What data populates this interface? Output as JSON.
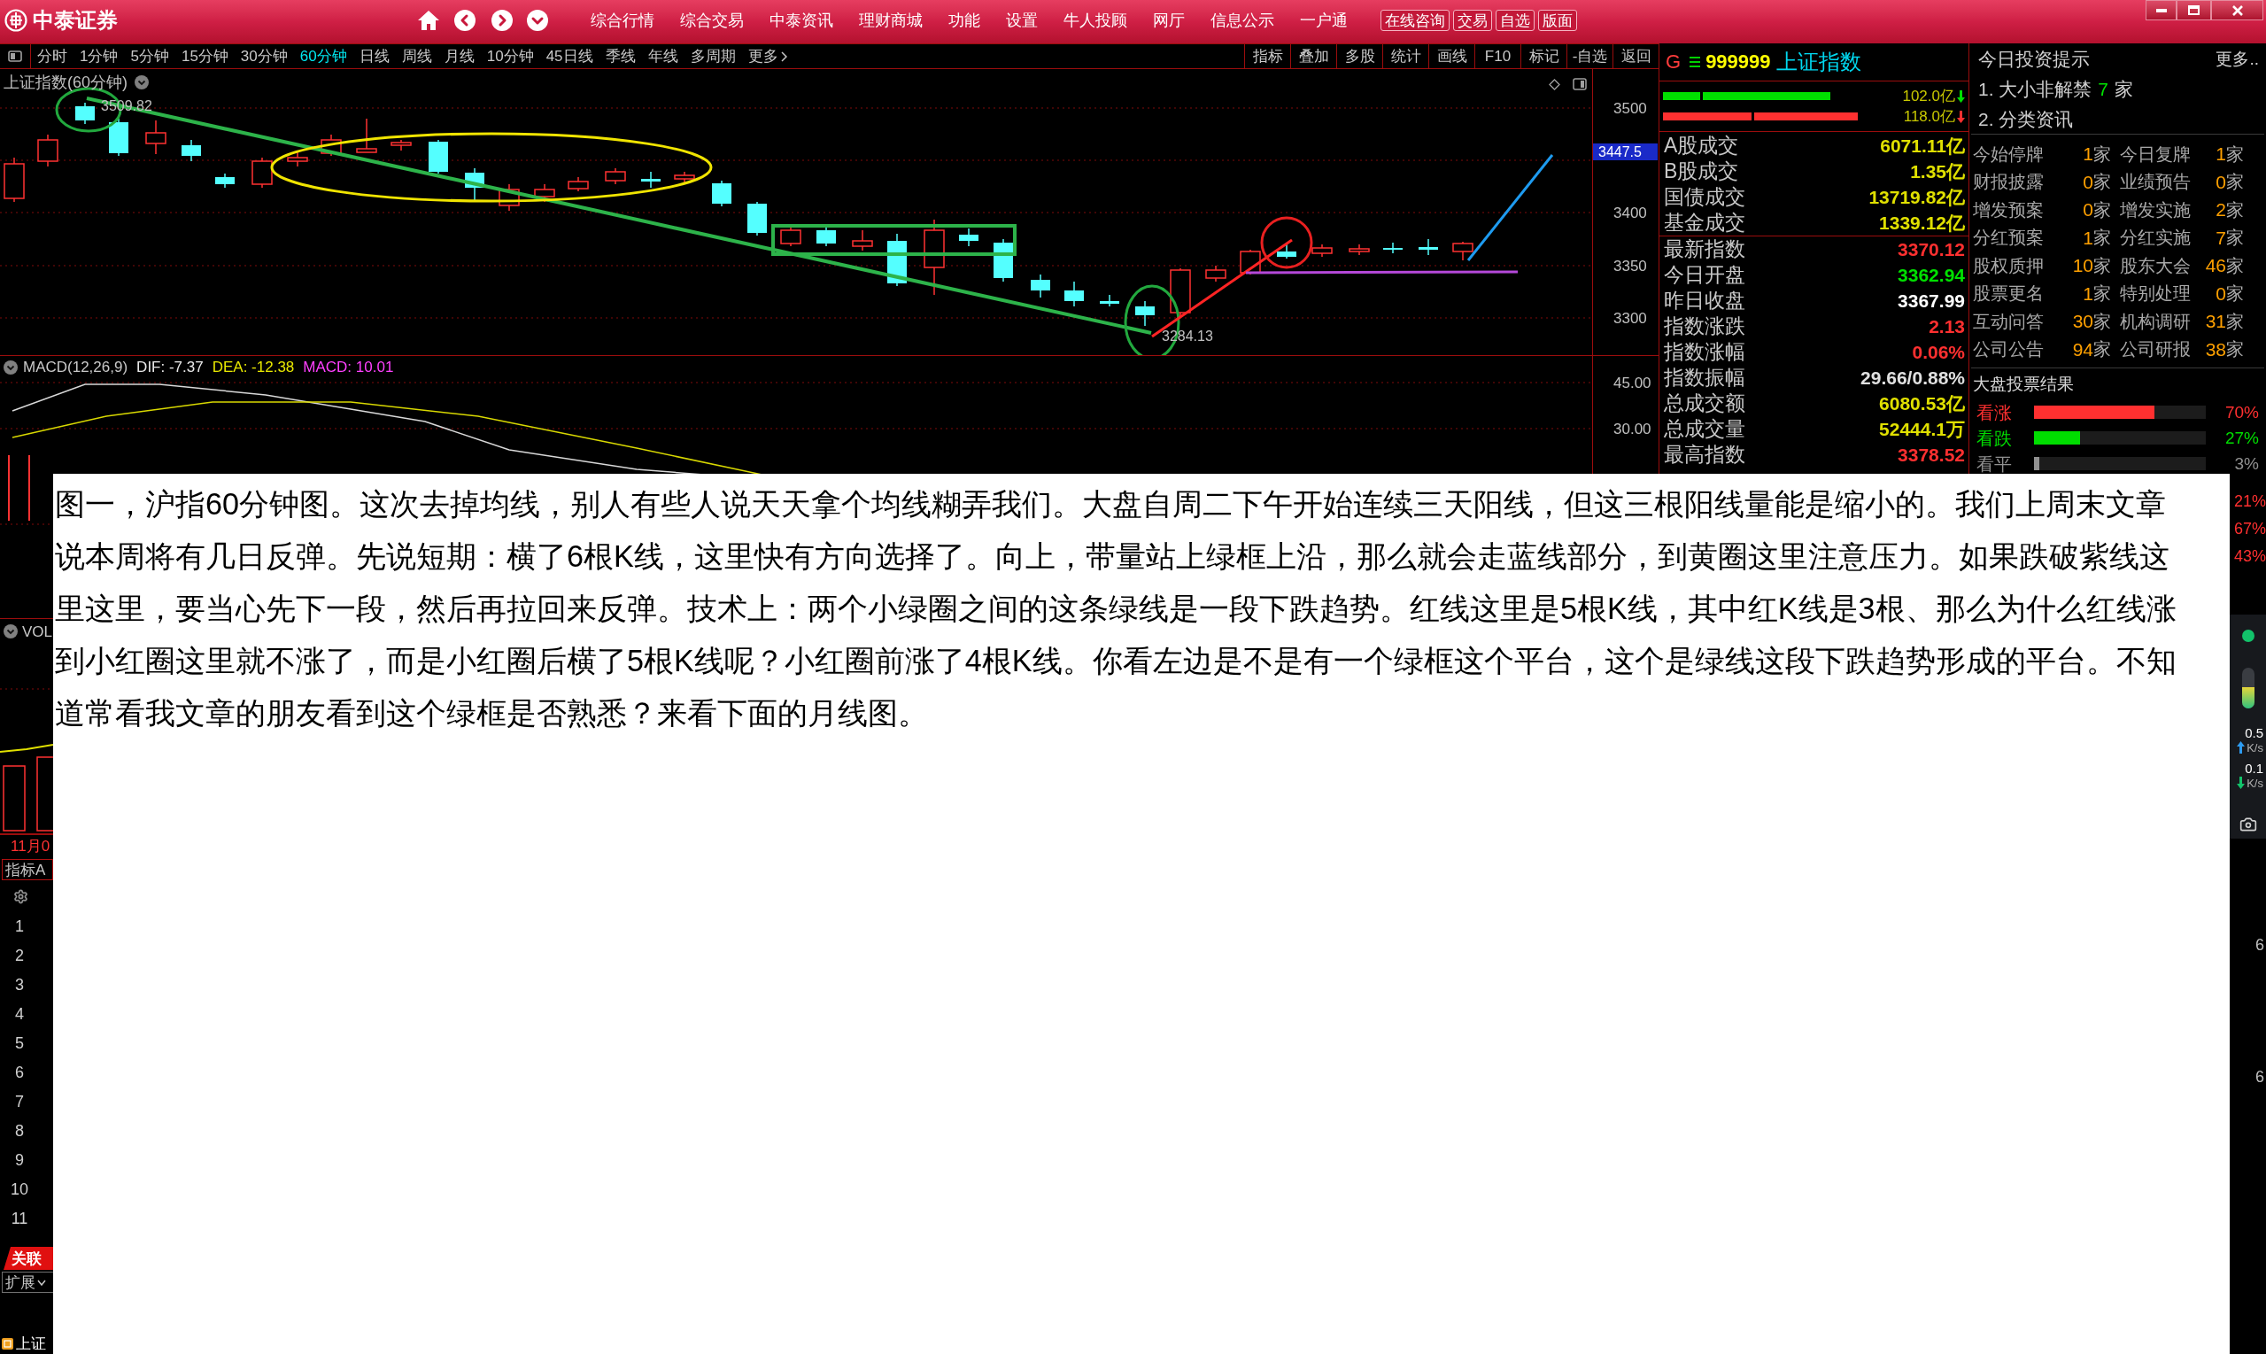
{
  "title_bar": {
    "logo": "中泰证券",
    "menu": [
      "综合行情",
      "综合交易",
      "中泰资讯",
      "理财商城",
      "功能",
      "设置",
      "牛人投顾",
      "网厅",
      "信息公示",
      "一户通"
    ],
    "buttons": [
      "在线咨询",
      "交易",
      "自选",
      "版面"
    ]
  },
  "toolbar": {
    "periods": [
      {
        "label": "分时",
        "selected": false
      },
      {
        "label": "1分钟",
        "selected": false
      },
      {
        "label": "5分钟",
        "selected": false
      },
      {
        "label": "15分钟",
        "selected": false
      },
      {
        "label": "30分钟",
        "selected": false
      },
      {
        "label": "60分钟",
        "selected": true
      },
      {
        "label": "日线",
        "selected": false
      },
      {
        "label": "周线",
        "selected": false
      },
      {
        "label": "月线",
        "selected": false
      },
      {
        "label": "10分钟",
        "selected": false
      },
      {
        "label": "45日线",
        "selected": false
      },
      {
        "label": "季线",
        "selected": false
      },
      {
        "label": "年线",
        "selected": false
      },
      {
        "label": "多周期",
        "selected": false
      }
    ],
    "more": "更多",
    "tools": [
      "指标",
      "叠加",
      "多股",
      "统计",
      "画线",
      "F10",
      "标记",
      "-自选",
      "返回"
    ]
  },
  "chart": {
    "title": "上证指数(60分钟)",
    "price_axis": [
      "3500",
      "3400",
      "3350",
      "3300"
    ],
    "last_price": "3447.5",
    "high_label": "3509.82",
    "low_label": "3284.13"
  },
  "macd": {
    "title": "MACD(12,26,9)",
    "dif": "DIF: -7.37",
    "dea": "DEA: -12.38",
    "value": "MACD: 10.01",
    "axis": [
      "45.00",
      "30.00"
    ]
  },
  "quote": {
    "flag": "G",
    "code": "999999",
    "name": "上证指数",
    "flows": [
      {
        "amount": "102.0亿",
        "color": "#00e000"
      },
      {
        "amount": "118.0亿",
        "color": "#ff3030"
      }
    ],
    "turnover": [
      {
        "label": "A股成交",
        "value": "6071.11亿"
      },
      {
        "label": "B股成交",
        "value": "1.35亿"
      },
      {
        "label": "国债成交",
        "value": "13719.82亿"
      },
      {
        "label": "基金成交",
        "value": "1339.12亿"
      }
    ],
    "indices": [
      {
        "label": "最新指数",
        "value": "3370.12",
        "color": "#ff3030"
      },
      {
        "label": "今日开盘",
        "value": "3362.94",
        "color": "#00e000"
      },
      {
        "label": "昨日收盘",
        "value": "3367.99",
        "color": "#ffffff"
      },
      {
        "label": "指数涨跌",
        "value": "2.13",
        "color": "#ff3030"
      },
      {
        "label": "指数涨幅",
        "value": "0.06%",
        "color": "#ff3030"
      },
      {
        "label": "指数振幅",
        "value": "29.66/0.88%",
        "color": "#e0e0e0"
      },
      {
        "label": "总成交额",
        "value": "6080.53亿",
        "color": "#e0e000"
      },
      {
        "label": "总成交量",
        "value": "52444.1万",
        "color": "#e0e000"
      },
      {
        "label": "最高指数",
        "value": "3378.52",
        "color": "#ff3030"
      }
    ]
  },
  "tips": {
    "title": "今日投资提示",
    "more": "更多..",
    "items": [
      {
        "text": "1. 大小非解禁",
        "count": "7",
        "unit": "家"
      },
      {
        "text": "2. 分类资讯"
      }
    ],
    "stats": [
      {
        "label": "今始停牌",
        "count": "1",
        "unit": "家"
      },
      {
        "label": "今日复牌",
        "count": "1",
        "unit": "家"
      },
      {
        "label": "财报披露",
        "count": "0",
        "unit": "家"
      },
      {
        "label": "业绩预告",
        "count": "0",
        "unit": "家"
      },
      {
        "label": "增发预案",
        "count": "0",
        "unit": "家"
      },
      {
        "label": "增发实施",
        "count": "2",
        "unit": "家"
      },
      {
        "label": "分红预案",
        "count": "1",
        "unit": "家"
      },
      {
        "label": "分红实施",
        "count": "7",
        "unit": "家"
      },
      {
        "label": "股权质押",
        "count": "10",
        "unit": "家"
      },
      {
        "label": "股东大会",
        "count": "46",
        "unit": "家"
      },
      {
        "label": "股票更名",
        "count": "1",
        "unit": "家"
      },
      {
        "label": "特别处理",
        "count": "0",
        "unit": "家"
      },
      {
        "label": "互动问答",
        "count": "30",
        "unit": "家"
      },
      {
        "label": "机构调研",
        "count": "31",
        "unit": "家"
      },
      {
        "label": "公司公告",
        "count": "94",
        "unit": "家"
      },
      {
        "label": "公司研报",
        "count": "38",
        "unit": "家"
      }
    ]
  },
  "vote": {
    "title": "大盘投票结果",
    "options": [
      {
        "label": "看涨",
        "level": 0.7,
        "percent": "70%",
        "color": "#ff3030"
      },
      {
        "label": "看跌",
        "level": 0.27,
        "percent": "27%",
        "color": "#00dd00"
      },
      {
        "label": "看平",
        "level": 0.03,
        "percent": "3%",
        "color": "#909090"
      }
    ]
  },
  "left_strip": {
    "volume_title": "VOL",
    "date_label": "11月0",
    "indicator_tab": "指标A",
    "row_numbers": [
      "1",
      "2",
      "3",
      "4",
      "5",
      "6",
      "7",
      "8",
      "9",
      "10",
      "11"
    ],
    "related_tab": "关联",
    "expand_menu": "扩展",
    "status": "上证"
  },
  "article": {
    "text": "图一，沪指60分钟图。这次去掉均线，别人有些人说天天拿个均线糊弄我们。大盘自周二下午开始连续三天阳线，但这三根阳线量能是缩小的。我们上周末文章说本周将有几日反弹。先说短期：横了6根K线，这里快有方向选择了。向上，带量站上绿框上沿，那么就会走蓝线部分，到黄圈这里注意压力。如果跌破紫线这里这里，要当心先下一段，然后再拉回来反弹。技术上：两个小绿圈之间的这条绿线是一段下跌趋势。红线这里是5根K线，其中红K线是3根、那么为什么红线涨到小红圈这里就不涨了，而是小红圈后横了5根K线呢？小红圈前涨了4根K线。你看左边是不是有一个绿框这个平台，这个是绿线这段下跌趋势形成的平台。不知道常看我文章的朋友看到这个绿框是否熟悉？来看下面的月线图。"
  },
  "right_strip": {
    "percents": [
      "21%",
      "67%",
      "43%"
    ],
    "speeds": [
      {
        "value": "0.5",
        "unit": "K/s",
        "kind": "upload"
      },
      {
        "value": "0.1",
        "unit": "K/s",
        "kind": "download"
      }
    ],
    "axis_fragments": [
      "6",
      "6"
    ]
  }
}
